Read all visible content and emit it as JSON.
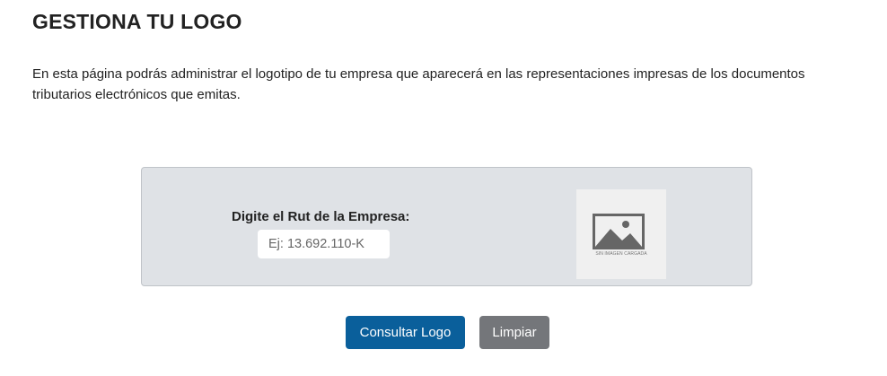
{
  "page": {
    "title": "GESTIONA TU LOGO",
    "description": "En esta página podrás administrar el logotipo de tu empresa que aparecerá en las representaciones impresas de los documentos tributarios electrónicos que emitas."
  },
  "form": {
    "rut_label": "Digite el Rut de la Empresa:",
    "rut_placeholder": "Ej: 13.692.110-K",
    "rut_value": ""
  },
  "logo_preview": {
    "icon": "image-placeholder-icon",
    "caption": "SIN IMAGEN CARGADA"
  },
  "actions": {
    "consult_label": "Consultar Logo",
    "clear_label": "Limpiar"
  },
  "colors": {
    "primary_button": "#0a5f9b",
    "secondary_button": "#74767a",
    "panel_background": "#dfe2e6"
  }
}
